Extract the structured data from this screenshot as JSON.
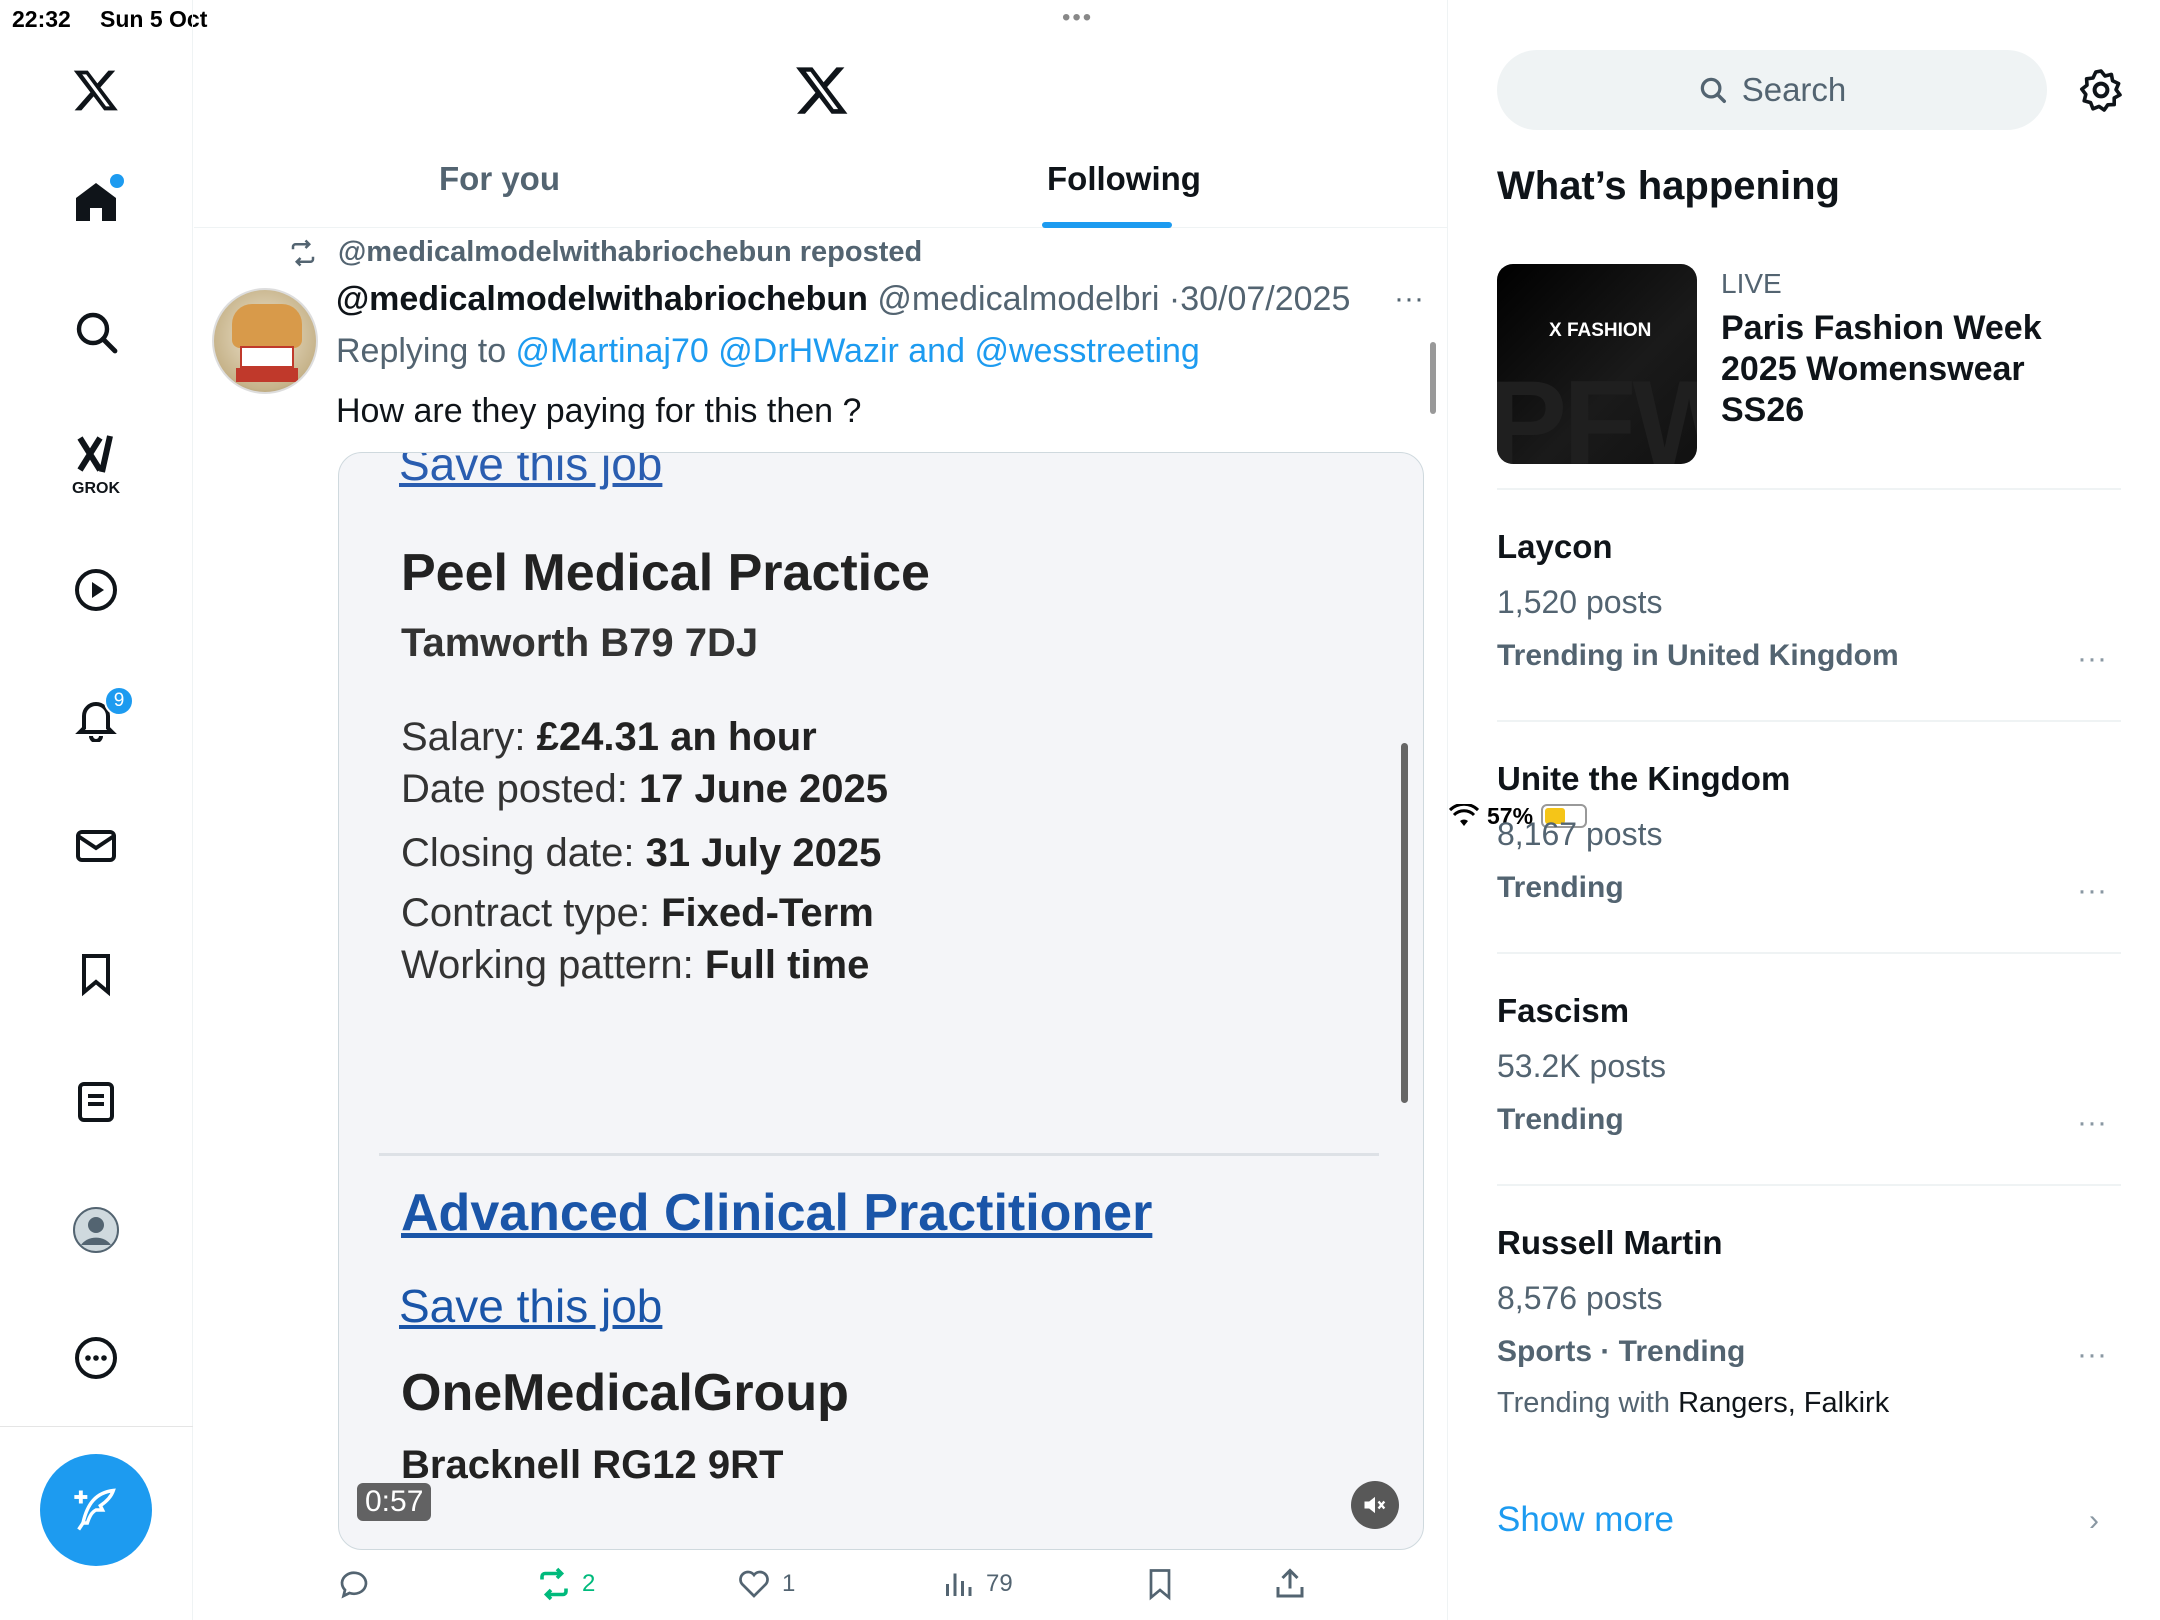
{
  "status": {
    "time": "22:32",
    "date": "Sun 5 Oct",
    "battery": "57%",
    "battery_level": 0.57
  },
  "nav": {
    "grok_label": "GROK",
    "notifications_badge": "9",
    "icons": [
      "x-logo-icon",
      "home-icon",
      "search-icon",
      "grok-icon",
      "video-icon",
      "bell-icon",
      "mail-icon",
      "bookmark-icon",
      "lists-icon",
      "profile-icon",
      "more-icon",
      "compose-icon"
    ]
  },
  "tabs": {
    "for_you": "For you",
    "following": "Following",
    "active": "Following"
  },
  "post": {
    "repost_text": "@medicalmodelwithabriochebun reposted",
    "author_name": "@medicalmodelwithabriochebun",
    "author_handle": "@medicalmodelbri",
    "date": "30/07/2025",
    "more": "···",
    "replying_prefix": "Replying to ",
    "reply_1": "@Martinaj70",
    "reply_2": "@DrHWazir",
    "reply_and": " and ",
    "reply_3": "@wesstreeting",
    "text": "How are they paying for this then ?",
    "media": {
      "save_job_1": "Save this job",
      "practice": "Peel Medical Practice",
      "location": "Tamworth B79 7DJ",
      "salary_label": "Salary: ",
      "salary_value": "£24.31 an hour",
      "date_posted_label": "Date posted: ",
      "date_posted_value": "17 June 2025",
      "closing_label": "Closing date: ",
      "closing_value": "31 July 2025",
      "contract_label": "Contract type: ",
      "contract_value": "Fixed-Term",
      "pattern_label": "Working pattern: ",
      "pattern_value": "Full time",
      "job_title": "Advanced Clinical Practitioner",
      "save_job_2": "Save this job",
      "org": "OneMedicalGroup",
      "location_2": "Bracknell RG12 9RT",
      "duration": "0:57"
    },
    "actions": {
      "reposts": "2",
      "likes": "1",
      "views": "79"
    }
  },
  "sidebar": {
    "search_placeholder": "Search",
    "heading": "What’s happening",
    "live": {
      "label": "LIVE",
      "title": "Paris Fashion Week 2025 Womenswear SS26",
      "thumb_brand": "X FASHION",
      "thumb_text": "PFW"
    },
    "trends": [
      {
        "name": "Laycon",
        "count": "1,520 posts",
        "category": "Trending in United Kingdom"
      },
      {
        "name": "Unite the Kingdom",
        "count": "8,167 posts",
        "category": "Trending"
      },
      {
        "name": "Fascism",
        "count": "53.2K posts",
        "category": "Trending"
      },
      {
        "name": "Russell Martin",
        "count": "8,576 posts",
        "category": "Sports · Trending",
        "with_prefix": "Trending with ",
        "with_value": "Rangers, Falkirk"
      }
    ],
    "show_more": "Show more",
    "trend_more": "···"
  },
  "colors": {
    "accent": "#1d9bf0",
    "text": "#0f1419",
    "muted": "#536471",
    "repost_green": "#00ba7c"
  }
}
